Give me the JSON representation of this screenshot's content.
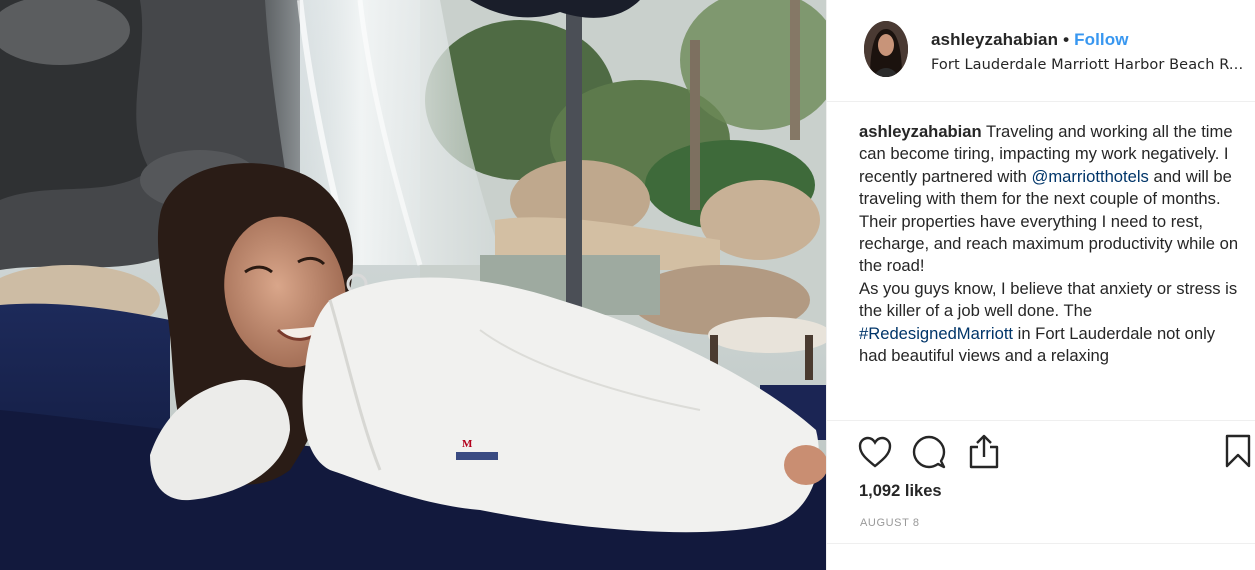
{
  "post": {
    "username": "ashleyzahabian",
    "separator": "•",
    "follow_label": "Follow",
    "location": "Fort Lauderdale Marriott Harbor Beach Re...",
    "caption": {
      "username": "ashleyzahabian",
      "part1": " Traveling and working all the time can become tiring, impacting my work negatively. I recently partnered with ",
      "mention": "@marriotthotels",
      "part2": " and will be traveling with them for the next couple of months. Their properties have everything I need to rest, recharge, and reach maximum productivity while on the road!",
      "part3": "As you guys know, I believe that anxiety or stress is the killer of a job well done. The ",
      "hashtag": "#RedesignedMarriott",
      "part4": " in Fort Lauderdale not only had beautiful views and a relaxing"
    },
    "likes": "1,092 likes",
    "date": "AUGUST 8",
    "icons": {
      "like": "heart-icon",
      "comment": "comment-bubble-icon",
      "share": "share-icon",
      "save": "bookmark-icon"
    },
    "colors": {
      "link": "#3897f0",
      "tag": "#003569",
      "text": "#262626",
      "muted": "#999999"
    }
  }
}
